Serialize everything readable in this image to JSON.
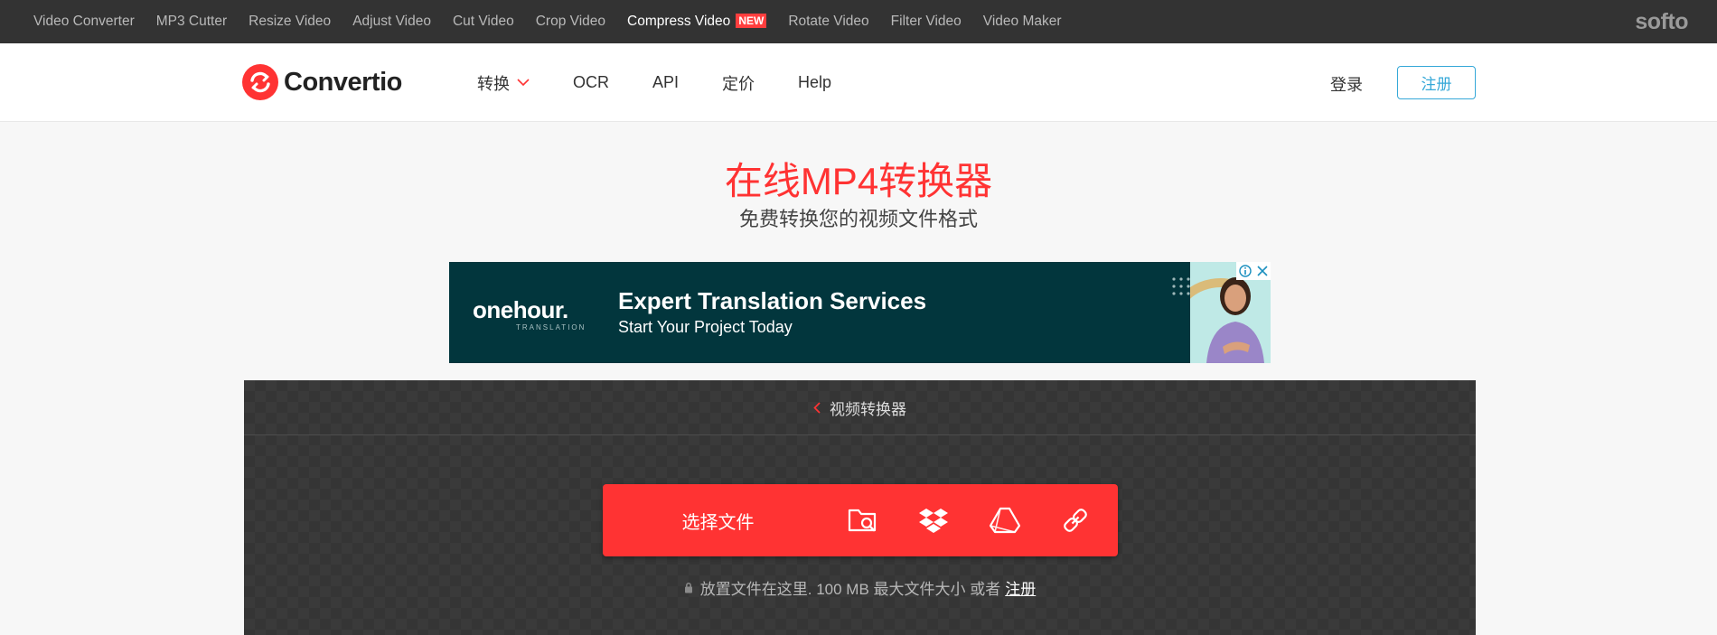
{
  "topbar": {
    "links": [
      {
        "label": "Video Converter"
      },
      {
        "label": "MP3 Cutter"
      },
      {
        "label": "Resize Video"
      },
      {
        "label": "Adjust Video"
      },
      {
        "label": "Cut Video"
      },
      {
        "label": "Crop Video"
      },
      {
        "label": "Compress Video",
        "badge": "NEW"
      },
      {
        "label": "Rotate Video"
      },
      {
        "label": "Filter Video"
      },
      {
        "label": "Video Maker"
      }
    ],
    "brand": "softo",
    "active_index": 6
  },
  "header": {
    "logo_text": "Convertio",
    "nav": [
      {
        "label": "转换",
        "icon": "chevron-down-icon"
      },
      {
        "label": "OCR"
      },
      {
        "label": "API"
      },
      {
        "label": "定价"
      },
      {
        "label": "Help"
      }
    ],
    "login_label": "登录",
    "signup_label": "注册"
  },
  "hero": {
    "title": "在线MP4转换器",
    "subtitle": "免费转换您的视频文件格式"
  },
  "ad": {
    "brand": "onehour.",
    "brand_sub": "TRANSLATION",
    "headline": "Expert Translation Services",
    "subline": "Start Your Project Today"
  },
  "converter": {
    "breadcrumb": "视频转换器",
    "choose_label": "选择文件",
    "sources": [
      "folder-search-icon",
      "dropbox-icon",
      "google-drive-icon",
      "url-link-icon"
    ],
    "drop_note": "放置文件在这里. 100 MB 最大文件大小 或者",
    "drop_note_link": "注册"
  },
  "colors": {
    "accent": "#ff3333",
    "topbar_bg": "#333333",
    "signup_border": "#35a8d8",
    "ad_bg": "#02363d"
  }
}
